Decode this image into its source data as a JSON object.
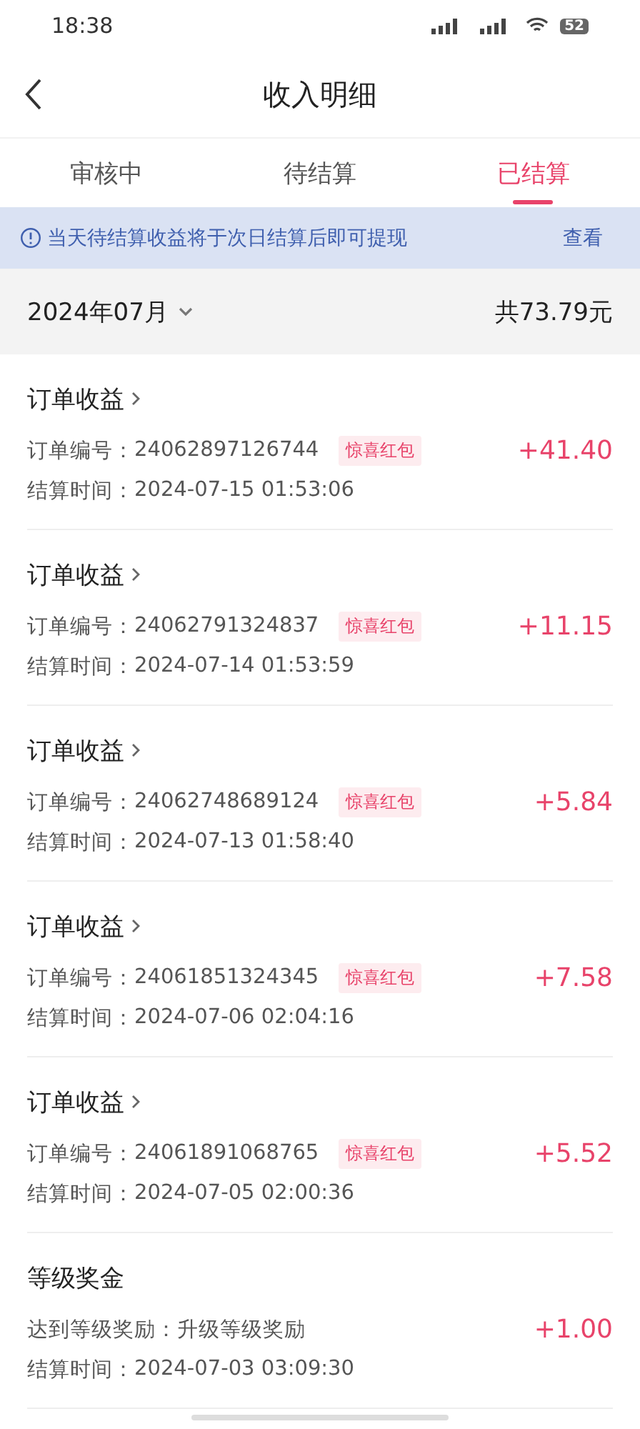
{
  "status_bar": {
    "time": "18:38",
    "battery": "52"
  },
  "nav": {
    "title": "收入明细"
  },
  "tabs": [
    {
      "label": "审核中",
      "selected": false
    },
    {
      "label": "待结算",
      "selected": false
    },
    {
      "label": "已结算",
      "selected": true
    }
  ],
  "notice": {
    "text": "当天待结算收益将于次日结算后即可提现",
    "action": "查看"
  },
  "month": {
    "label": "2024年07月",
    "total": "共73.79元"
  },
  "records": [
    {
      "title": "订单收益",
      "link": true,
      "line1_label": "订单编号：",
      "line1_value": "24062897126744",
      "tag": "惊喜红包",
      "time_label": "结算时间：",
      "time": "2024-07-15 01:53:06",
      "amount": "+41.40"
    },
    {
      "title": "订单收益",
      "link": true,
      "line1_label": "订单编号：",
      "line1_value": "24062791324837",
      "tag": "惊喜红包",
      "time_label": "结算时间：",
      "time": "2024-07-14 01:53:59",
      "amount": "+11.15"
    },
    {
      "title": "订单收益",
      "link": true,
      "line1_label": "订单编号：",
      "line1_value": "24062748689124",
      "tag": "惊喜红包",
      "time_label": "结算时间：",
      "time": "2024-07-13 01:58:40",
      "amount": "+5.84"
    },
    {
      "title": "订单收益",
      "link": true,
      "line1_label": "订单编号：",
      "line1_value": "24061851324345",
      "tag": "惊喜红包",
      "time_label": "结算时间：",
      "time": "2024-07-06 02:04:16",
      "amount": "+7.58"
    },
    {
      "title": "订单收益",
      "link": true,
      "line1_label": "订单编号：",
      "line1_value": "24061891068765",
      "tag": "惊喜红包",
      "time_label": "结算时间：",
      "time": "2024-07-05 02:00:36",
      "amount": "+5.52"
    },
    {
      "title": "等级奖金",
      "link": false,
      "line1_label": "达到等级奖励：",
      "line1_value": "升级等级奖励",
      "time_label": "结算时间：",
      "time": "2024-07-03 03:09:30",
      "amount": "+1.00"
    }
  ]
}
